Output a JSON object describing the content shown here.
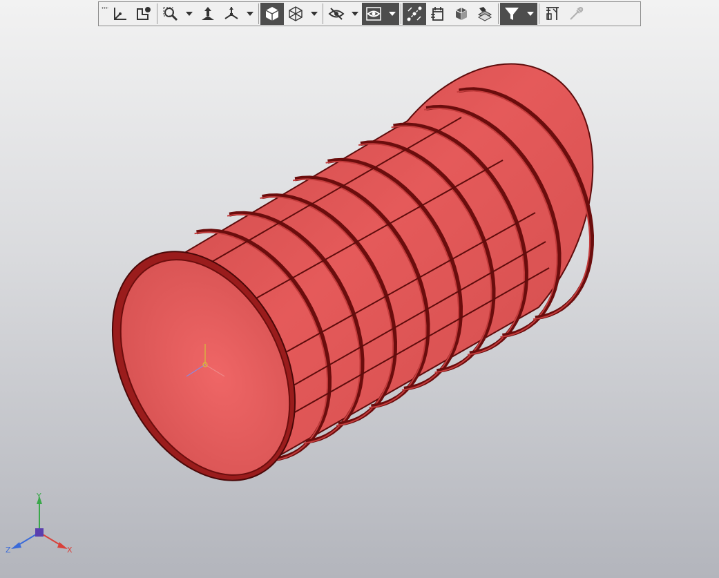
{
  "toolbar": {
    "buttons": [
      {
        "name": "coordinate-system-icon"
      },
      {
        "name": "local-cs-icon"
      },
      {
        "name": "zoom-window-icon"
      },
      {
        "name": "normal-to-icon"
      },
      {
        "name": "orientation-icon"
      },
      {
        "name": "shaded-view-icon",
        "active": true
      },
      {
        "name": "wireframe-view-icon"
      },
      {
        "name": "hide-icon"
      },
      {
        "name": "show-hidden-icon",
        "active": true
      },
      {
        "name": "sketch-points-icon",
        "active": true
      },
      {
        "name": "section-icon"
      },
      {
        "name": "explode-icon"
      },
      {
        "name": "layers-icon"
      },
      {
        "name": "filter-icon",
        "active": true
      },
      {
        "name": "measure-icon"
      },
      {
        "name": "pipette-icon",
        "disabled": true
      }
    ]
  },
  "triad": {
    "x_label": "X",
    "y_label": "Y",
    "z_label": "Z",
    "x_color": "#d9413a",
    "y_color": "#3aa84a",
    "z_color": "#3a6ad9"
  },
  "model": {
    "body_color": "#e05555",
    "edge_color": "#6b0d0d",
    "ring_count": 9
  }
}
